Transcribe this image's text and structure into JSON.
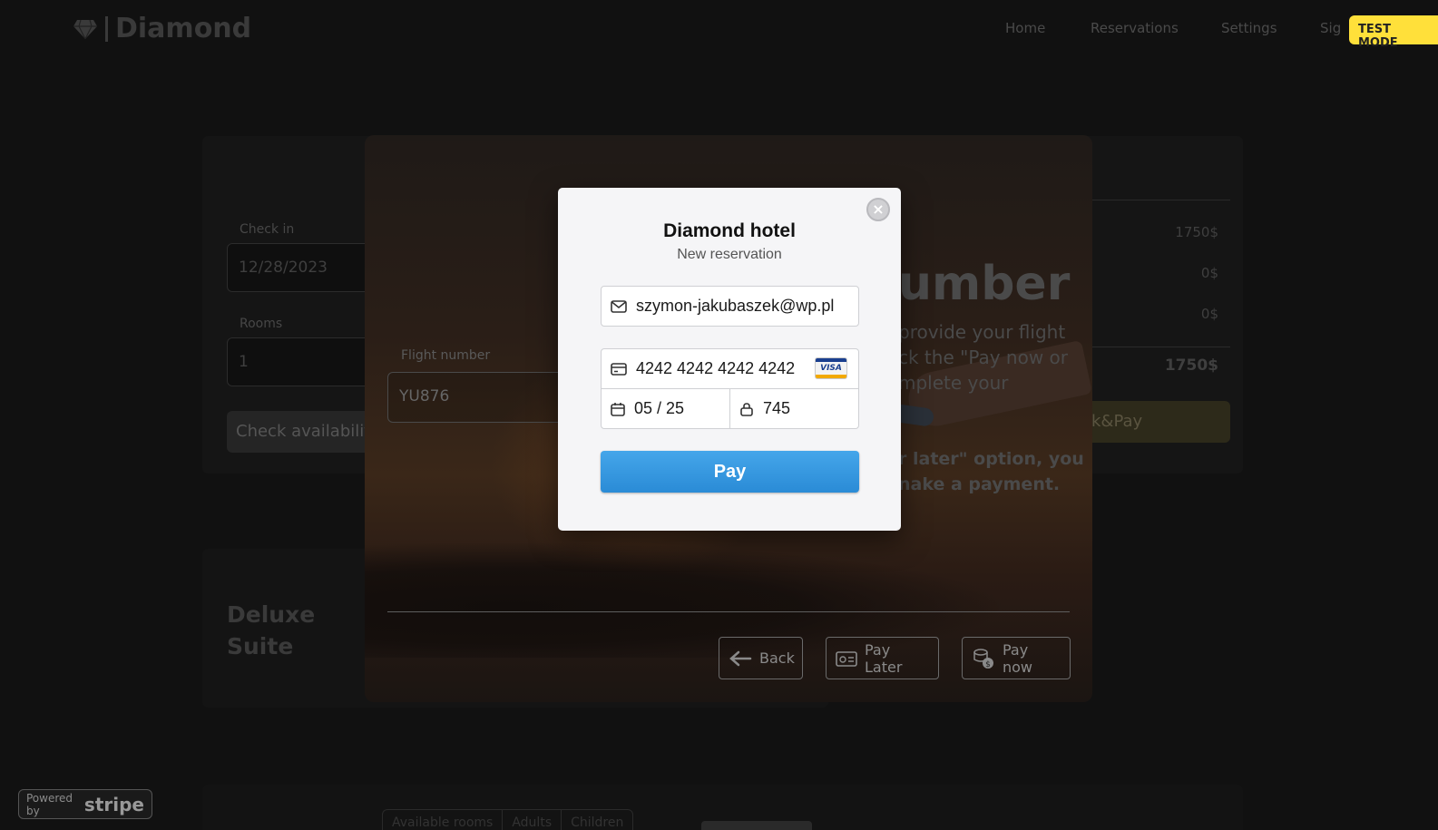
{
  "nav": {
    "brand": "Diamond",
    "links": [
      "Home",
      "Reservations",
      "Settings",
      "Sig"
    ],
    "test_mode": "TEST MODE"
  },
  "booking": {
    "check_in_label": "Check in",
    "check_in_value": "12/28/2023",
    "rooms_label": "Rooms",
    "rooms_value": "1",
    "check_button": "Check availabilit",
    "prices": [
      "1750$",
      "0$",
      "0$"
    ],
    "total": "1750$",
    "book_button": "ok&Pay"
  },
  "room": {
    "title_line1": "Deluxe",
    "title_line2": "Suite"
  },
  "table_tabs": [
    "Available rooms",
    "Adults",
    "Children"
  ],
  "flight_modal": {
    "heading": "umber",
    "description": "provide your flight ck the \"Pay now or mplete your",
    "note": "r later\" option, you nake a payment.",
    "flight_label": "Flight number",
    "flight_value": "YU876",
    "back_button": "Back",
    "pay_later_button": "Pay Later",
    "pay_now_button": "Pay now"
  },
  "stripe_badge": {
    "powered": "Powered by",
    "brand": "stripe"
  },
  "checkout": {
    "title": "Diamond hotel",
    "subtitle": "New reservation",
    "email": "szymon-jakubaszek@wp.pl",
    "card_number": "4242 4242 4242 4242",
    "card_brand": "VISA",
    "expiry": "05 / 25",
    "cvc": "745",
    "pay_button": "Pay",
    "close_glyph": "×"
  }
}
